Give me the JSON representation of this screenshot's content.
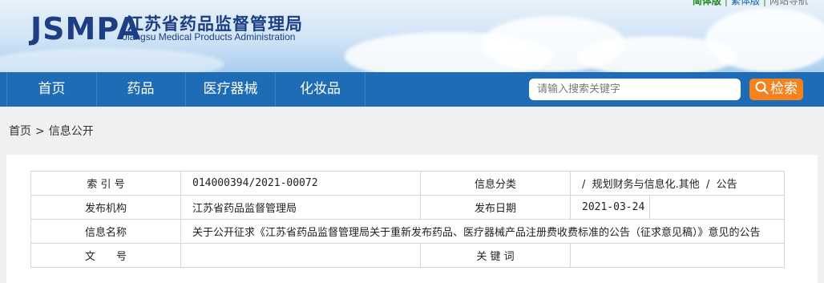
{
  "header": {
    "logo_abbr": "JSMPA",
    "org_cn": "江苏省药品监督管理局",
    "org_en": "Jiangsu Medical Products Administration",
    "top_links": [
      "简体版",
      "繁体版",
      "网站导航"
    ]
  },
  "nav": {
    "items": [
      "首页",
      "药品",
      "医疗器械",
      "化妆品"
    ],
    "search_placeholder": "请输入搜索关键字",
    "search_button": "检索"
  },
  "breadcrumb": {
    "home": "首页",
    "separator": ">",
    "current": "信息公开"
  },
  "info_table": {
    "index_label": "索 引 号",
    "index_value": "014000394/2021-00072",
    "category_label": "信息分类",
    "category_value": "/  规划财务与信息化.其他  /  公告",
    "publisher_label": "发布机构",
    "publisher_value": "江苏省药品监督管理局",
    "date_label": "发布日期",
    "date_value": "2021-03-24",
    "name_label": "信息名称",
    "name_value": "关于公开征求《江苏省药品监督管理局关于重新发布药品、医疗器械产品注册费收费标准的公告（征求意见稿）》意见的公告",
    "doc_no_label": "文　　号",
    "doc_no_value": "",
    "keywords_label": "关 键 词",
    "keywords_value": ""
  }
}
